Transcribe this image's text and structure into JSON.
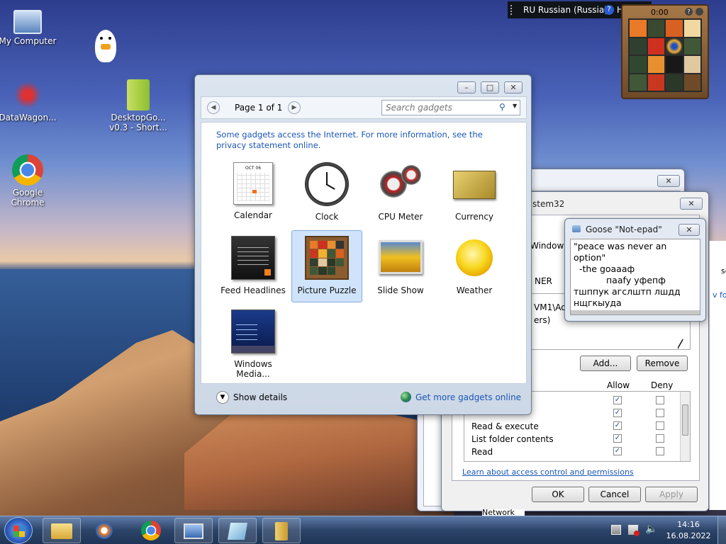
{
  "desktop": {
    "icons": [
      {
        "label": "My Computer"
      },
      {
        "label": "DataWagon..."
      },
      {
        "label": "Google Chrome"
      },
      {
        "label": "DesktopGo... v0.3 - Short..."
      }
    ]
  },
  "language_bar": {
    "language": "RU Russian (Russia)",
    "help": "Help"
  },
  "puzzle_gadget": {
    "time": "0:00"
  },
  "gadgets_window": {
    "page": "Page 1 of 1",
    "search_placeholder": "Search gadgets",
    "info": "Some gadgets access the Internet.  For more information, see the privacy statement online.",
    "gadgets": [
      {
        "label": "Calendar"
      },
      {
        "label": "Clock"
      },
      {
        "label": "CPU Meter"
      },
      {
        "label": "Currency"
      },
      {
        "label": "Feed Headlines"
      },
      {
        "label": "Picture Puzzle"
      },
      {
        "label": "Slide Show"
      },
      {
        "label": "Weather"
      },
      {
        "label": "Windows Media..."
      }
    ],
    "calendar_month": "OCT 06",
    "show_details": "Show details",
    "get_more": "Get more gadgets online"
  },
  "security_dialog": {
    "title_fragment": "stem32",
    "path_fragment": "Windows\\",
    "owner_fragment": "NER",
    "user_fragment": "VM1\\Adm",
    "group_fragment": "ers)",
    "add": "Add...",
    "remove": "Remove",
    "allow": "Allow",
    "deny": "Deny",
    "permissions": [
      "Read & execute",
      "List folder contents",
      "Read"
    ],
    "learn": "Learn about access control and permissions",
    "ok": "OK",
    "cancel": "Cancel",
    "apply": "Apply"
  },
  "notepad": {
    "title": "Goose \"Not-epad\"",
    "line1": "\"peace was never an option\"",
    "line2": "  -the goaaaф",
    "line3": "пааfу уфепф",
    "line4": "тшппук агслштп лшдд",
    "line5": "нщгкыуда"
  },
  "right_edge": {
    "text1": "se",
    "text2": "v fold"
  },
  "taskbar": {
    "time": "14:16",
    "date": "16.08.2022",
    "network_fragment": "Network"
  },
  "colors": {
    "link": "#1a56b8",
    "taskbar": "#2c4468",
    "selected": "#cfe3fb"
  }
}
